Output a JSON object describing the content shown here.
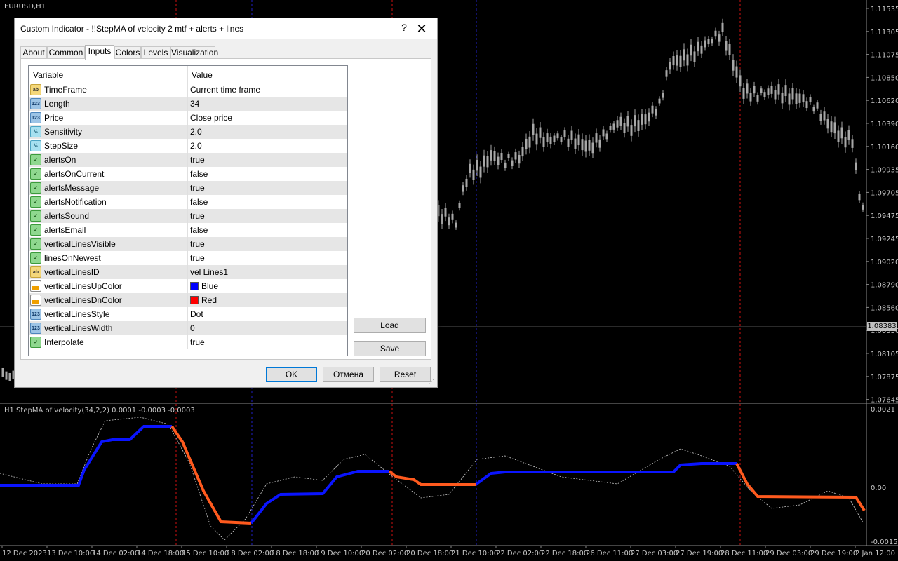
{
  "chart": {
    "symbol_title": "EURUSD,H1",
    "price_badge": "1.08383",
    "price_ticks": [
      "1.11535",
      "1.11305",
      "1.11075",
      "1.10850",
      "1.10620",
      "1.10390",
      "1.10160",
      "1.09935",
      "1.09705",
      "1.09475",
      "1.09245",
      "1.09020",
      "1.08790",
      "1.08560",
      "1.08330",
      "1.08105",
      "1.07875",
      "1.07645"
    ],
    "indicator_title": "H1 StepMA of velocity(34,2,2) 0.0001 -0.0003 -0.0003",
    "indicator_ticks": [
      "0.0021",
      "0.00",
      "-0.0015"
    ],
    "time_labels": [
      "12 Dec 2023",
      "13 Dec 10:00",
      "14 Dec 02:00",
      "14 Dec 18:00",
      "15 Dec 10:00",
      "18 Dec 02:00",
      "18 Dec 18:00",
      "19 Dec 10:00",
      "20 Dec 02:00",
      "20 Dec 18:00",
      "21 Dec 10:00",
      "22 Dec 02:00",
      "22 Dec 18:00",
      "26 Dec 11:00",
      "27 Dec 03:00",
      "27 Dec 19:00",
      "28 Dec 11:00",
      "29 Dec 03:00",
      "29 Dec 19:00",
      "2 Jan 12:00"
    ],
    "colors": {
      "background": "#000000",
      "grid": "#1a1a1a",
      "up": "#0a14ff",
      "down": "#ff5a1e",
      "candles": "#a8a8a8",
      "vline_red": "#d01010",
      "vline_blue": "#2020c8"
    }
  },
  "dialog": {
    "title": "Custom Indicator - !!StepMA of velocity 2 mtf + alerts + lines",
    "help_glyph": "?",
    "close_glyph": "✕",
    "tabs": [
      {
        "label": "About",
        "active": false
      },
      {
        "label": "Common",
        "active": false
      },
      {
        "label": "Inputs",
        "active": true
      },
      {
        "label": "Colors",
        "active": false
      },
      {
        "label": "Levels",
        "active": false
      },
      {
        "label": "Visualization",
        "active": false
      }
    ],
    "grid_headers": {
      "variable": "Variable",
      "value": "Value"
    },
    "rows": [
      {
        "icon": "str",
        "icon_text": "ab",
        "name": "TimeFrame",
        "value": "Current time frame"
      },
      {
        "icon": "int",
        "icon_text": "123",
        "name": "Length",
        "value": "34"
      },
      {
        "icon": "int",
        "icon_text": "123",
        "name": "Price",
        "value": "Close price"
      },
      {
        "icon": "dbl",
        "icon_text": "½",
        "name": "Sensitivity",
        "value": "2.0"
      },
      {
        "icon": "dbl",
        "icon_text": "½",
        "name": "StepSize",
        "value": "2.0"
      },
      {
        "icon": "bool",
        "icon_text": "✓",
        "name": "alertsOn",
        "value": "true"
      },
      {
        "icon": "bool",
        "icon_text": "✓",
        "name": "alertsOnCurrent",
        "value": "false"
      },
      {
        "icon": "bool",
        "icon_text": "✓",
        "name": "alertsMessage",
        "value": "true"
      },
      {
        "icon": "bool",
        "icon_text": "✓",
        "name": "alertsNotification",
        "value": "false"
      },
      {
        "icon": "bool",
        "icon_text": "✓",
        "name": "alertsSound",
        "value": "true"
      },
      {
        "icon": "bool",
        "icon_text": "✓",
        "name": "alertsEmail",
        "value": "false"
      },
      {
        "icon": "bool",
        "icon_text": "✓",
        "name": "verticalLinesVisible",
        "value": "true"
      },
      {
        "icon": "bool",
        "icon_text": "✓",
        "name": "linesOnNewest",
        "value": "true"
      },
      {
        "icon": "str",
        "icon_text": "ab",
        "name": "verticalLinesID",
        "value": "vel Lines1"
      },
      {
        "icon": "col",
        "icon_text": "",
        "name": "verticalLinesUpColor",
        "value": "Blue",
        "swatch": "#0000ff"
      },
      {
        "icon": "col",
        "icon_text": "",
        "name": "verticalLinesDnColor",
        "value": "Red",
        "swatch": "#ff0000"
      },
      {
        "icon": "int",
        "icon_text": "123",
        "name": "verticalLinesStyle",
        "value": "Dot"
      },
      {
        "icon": "int",
        "icon_text": "123",
        "name": "verticalLinesWidth",
        "value": "0"
      },
      {
        "icon": "bool",
        "icon_text": "✓",
        "name": "Interpolate",
        "value": "true"
      }
    ],
    "buttons": {
      "load": "Load",
      "save": "Save",
      "ok": "OK",
      "cancel": "Отмена",
      "reset": "Reset"
    }
  }
}
